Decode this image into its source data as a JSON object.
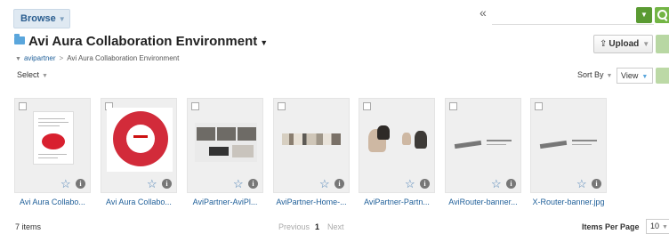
{
  "toolbar": {
    "browse_label": "Browse",
    "collapse_glyph": "«",
    "search_placeholder": "",
    "upload_label": "Upload"
  },
  "header": {
    "title": "Avi Aura Collaboration Environment",
    "breadcrumb": [
      "avipartner",
      "Avi Aura Collaboration Environment"
    ]
  },
  "listbar": {
    "select_label": "Select",
    "sort_label": "Sort By",
    "view_label": "View"
  },
  "items": [
    {
      "name": "Avi Aura Collabo...",
      "thumb": "document-page"
    },
    {
      "name": "Avi Aura Collabo...",
      "thumb": "red-wheel-diagram"
    },
    {
      "name": "AviPartner-AviPl...",
      "thumb": "video-conference-photo"
    },
    {
      "name": "AviPartner-Home-...",
      "thumb": "image-strip"
    },
    {
      "name": "AviPartner-Partn...",
      "thumb": "people-photos"
    },
    {
      "name": "AviRouter-banner...",
      "thumb": "router-banner"
    },
    {
      "name": "X-Router-banner.jpg",
      "thumb": "router-banner"
    }
  ],
  "footer": {
    "count": "7 items",
    "prev_label": "Previous",
    "current_page": "1",
    "next_label": "Next",
    "ipp_label": "Items Per Page",
    "ipp_value": "10"
  },
  "colors": {
    "accent_green": "#73b545",
    "link_blue": "#1f5f99",
    "folder_blue": "#5aa6dc",
    "brand_red": "#d22b3a"
  },
  "icons": [
    "folder-icon",
    "search-icon",
    "filter-icon",
    "star-icon",
    "info-icon",
    "upload-icon",
    "refresh-icon"
  ]
}
